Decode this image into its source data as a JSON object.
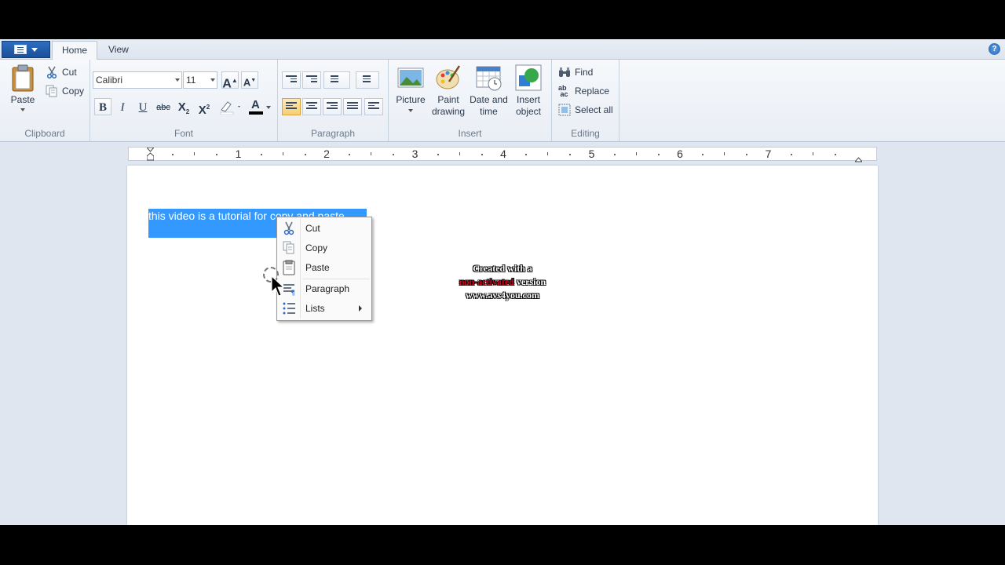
{
  "tabs": {
    "home": "Home",
    "view": "View"
  },
  "help_label": "?",
  "clipboard": {
    "paste": "Paste",
    "cut": "Cut",
    "copy": "Copy",
    "group": "Clipboard"
  },
  "font": {
    "family": "Calibri",
    "size": "11",
    "grow_label": "A",
    "shrink_label": "A",
    "bold": "B",
    "italic": "I",
    "underline": "U",
    "strike": "abc",
    "subscript": "X",
    "superscript": "X",
    "color_label": "A",
    "group": "Font"
  },
  "paragraph": {
    "group": "Paragraph"
  },
  "insert": {
    "picture": "Picture",
    "paint_drawing_1": "Paint",
    "paint_drawing_2": "drawing",
    "date_time_1": "Date and",
    "date_time_2": "time",
    "insert_object_1": "Insert",
    "insert_object_2": "object",
    "group": "Insert"
  },
  "editing": {
    "find": "Find",
    "replace": "Replace",
    "select_all": "Select all",
    "group": "Editing"
  },
  "ruler": {
    "numbers": [
      "1",
      "2",
      "3",
      "4",
      "5",
      "6",
      "7"
    ]
  },
  "document": {
    "text": "this video is a tutorial for copy and paste"
  },
  "context_menu": {
    "cut": "Cut",
    "copy": "Copy",
    "paste": "Paste",
    "paragraph": "Paragraph",
    "lists": "Lists"
  },
  "watermark": {
    "line1": "Created with a",
    "line2_red": "non-activated",
    "line2_rest": " version",
    "line3": "www.avs4you.com"
  },
  "colors": {
    "selection": "#3399ff",
    "accent": "#1b4f9a",
    "font_color_bar": "#000000"
  }
}
